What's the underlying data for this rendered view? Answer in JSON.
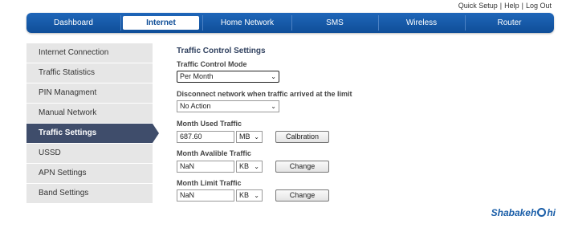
{
  "top_links": {
    "quick_setup": "Quick Setup",
    "help": "Help",
    "logout": "Log Out",
    "sep": "|"
  },
  "nav": {
    "tabs": [
      {
        "label": "Dashboard"
      },
      {
        "label": "Internet"
      },
      {
        "label": "Home Network"
      },
      {
        "label": "SMS"
      },
      {
        "label": "Wireless"
      },
      {
        "label": "Router"
      }
    ],
    "active": "Internet"
  },
  "sidebar": {
    "items": [
      {
        "label": "Internet Connection"
      },
      {
        "label": "Traffic Statistics"
      },
      {
        "label": "PIN Managment"
      },
      {
        "label": "Manual Network"
      },
      {
        "label": "Traffic Settings"
      },
      {
        "label": "USSD"
      },
      {
        "label": "APN Settings"
      },
      {
        "label": "Band Settings"
      }
    ],
    "active": "Traffic Settings"
  },
  "main": {
    "title": "Traffic Control Settings",
    "mode": {
      "label": "Traffic Control Mode",
      "value": "Per Month"
    },
    "disconnect": {
      "label": "Disconnect network when traffic arrived at the limit",
      "value": "No Action"
    },
    "used": {
      "label": "Month Used Traffic",
      "value": "687.60",
      "unit": "MB",
      "button": "Calbration"
    },
    "available": {
      "label": "Month Avalible Traffic",
      "value": "NaN",
      "unit": "KB",
      "button": "Change"
    },
    "limit": {
      "label": "Month Limit Traffic",
      "value": "NaN",
      "unit": "KB",
      "button": "Change"
    }
  },
  "watermark": {
    "text_a": "Shabakeh",
    "text_b": "hi"
  },
  "colors": {
    "nav_blue": "#1f66b9",
    "sidebar_active": "#3f4d6b",
    "title_color": "#30415f"
  }
}
